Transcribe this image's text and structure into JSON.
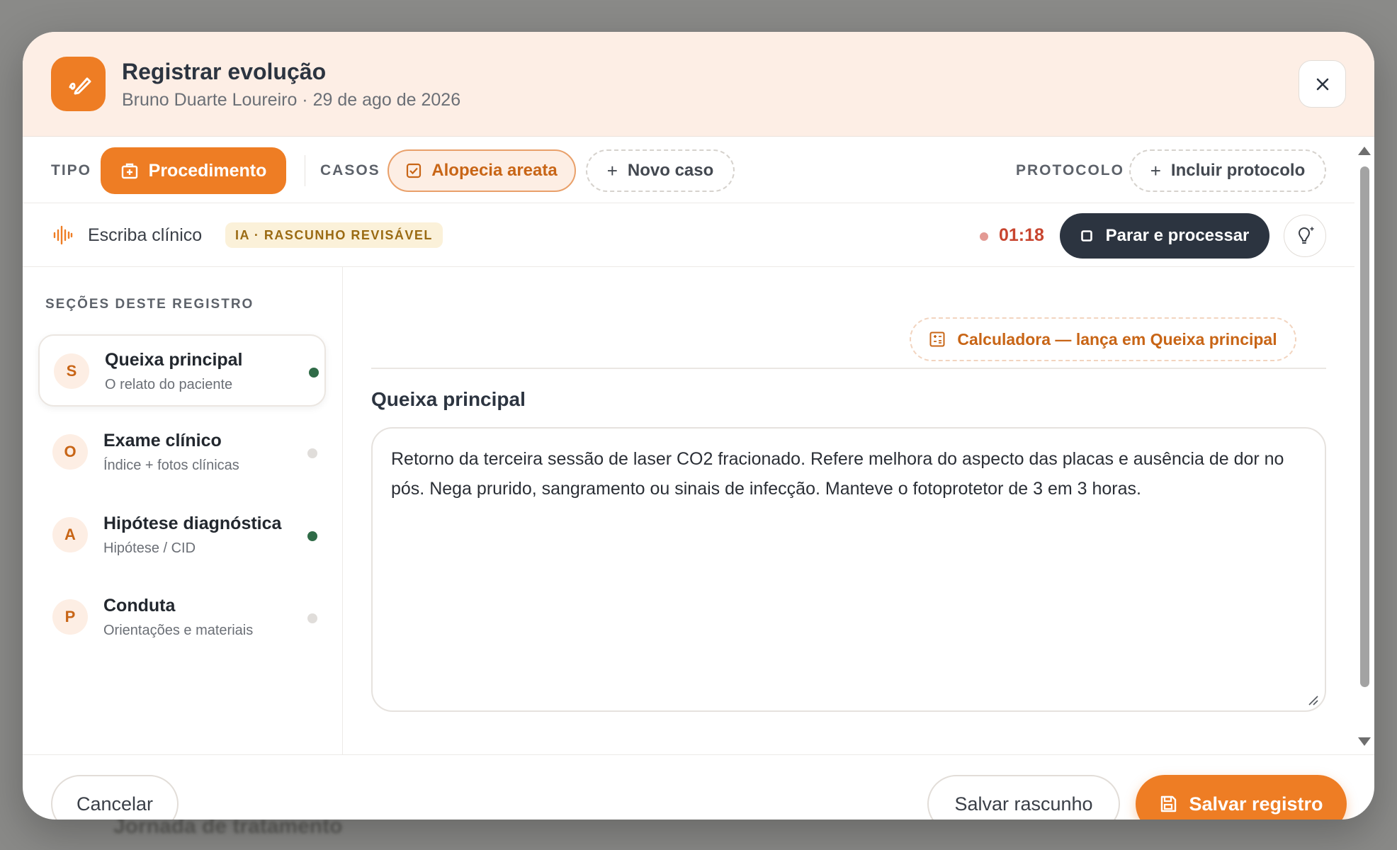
{
  "background": {
    "partial_text": "Jornada de tratamento"
  },
  "header": {
    "title": "Registrar evolução",
    "subtitle": "Bruno Duarte Loureiro · 29 de ago de 2026",
    "icon": "pen-icon",
    "close_icon": "close-icon"
  },
  "type_row": {
    "tipo_label": "TIPO",
    "procedure_button": "Procedimento",
    "casos_label": "CASOS",
    "case_chip": "Alopecia areata",
    "new_case_button": "Novo caso",
    "protocolo_label": "PROTOCOLO",
    "include_protocol_button": "Incluir protocolo"
  },
  "scribe": {
    "label": "Escriba clínico",
    "badge": "IA · RASCUNHO REVISÁVEL",
    "timer": "01:18",
    "stop_button": "Parar e processar",
    "icon": "waveform-icon",
    "bulb_icon": "lightbulb-icon"
  },
  "sidebar": {
    "title": "SEÇÕES DESTE REGISTRO",
    "sections": [
      {
        "letter": "S",
        "name": "Queixa principal",
        "desc": "O relato do paciente",
        "filled": true,
        "active": true
      },
      {
        "letter": "O",
        "name": "Exame clínico",
        "desc": "Índice + fotos clínicas",
        "filled": false,
        "active": false
      },
      {
        "letter": "A",
        "name": "Hipótese diagnóstica",
        "desc": "Hipótese / CID",
        "filled": true,
        "active": false
      },
      {
        "letter": "P",
        "name": "Conduta",
        "desc": "Orientações e materiais",
        "filled": false,
        "active": false
      }
    ]
  },
  "main": {
    "calculator_button": "Calculadora — lança em Queixa principal",
    "section_title": "Queixa principal",
    "text": "Retorno da terceira sessão de laser CO2 fracionado. Refere melhora do aspecto das placas e ausência de dor no pós. Nega prurido, sangramento ou sinais de infecção. Manteve o fotoprotetor de 3 em 3 horas."
  },
  "footer": {
    "cancel_button": "Cancelar",
    "draft_button": "Salvar rascunho",
    "save_button": "Salvar registro"
  },
  "colors": {
    "accent": "#ee7d24",
    "header_bg": "#fdeee5",
    "dark_button": "#2c3440",
    "filled_dot": "#2f6b47",
    "empty_dot": "#e0ddda",
    "timer": "#c8452f"
  }
}
